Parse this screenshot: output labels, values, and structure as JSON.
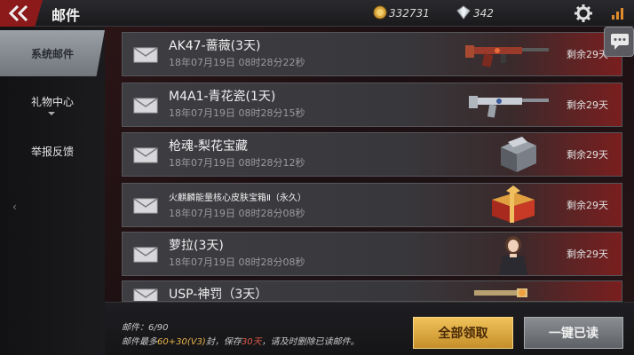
{
  "header": {
    "title": "邮件",
    "gold": "332731",
    "gems": "342",
    "back_icon": "back-chevron-icon",
    "settings_icon": "gear-icon",
    "signal_icon": "signal-bars-icon"
  },
  "sidebar": {
    "items": [
      {
        "label": "系统邮件",
        "active": true
      },
      {
        "label": "礼物中心",
        "active": false
      },
      {
        "label": "举报反馈",
        "active": false
      }
    ]
  },
  "mails": [
    {
      "title": "AK47-蔷薇(3天)",
      "date": "18年07月19日 08时28分22秒",
      "remaining": "剩余29天",
      "item_icon": "rifle-icon"
    },
    {
      "title": "M4A1-青花瓷(1天)",
      "date": "18年07月19日 08时28分15秒",
      "remaining": "剩余29天",
      "item_icon": "rifle-icon"
    },
    {
      "title": "枪魂-梨花宝藏",
      "date": "18年07月19日 08时28分12秒",
      "remaining": "剩余29天",
      "item_icon": "treasure-box-icon"
    },
    {
      "title": "火麒麟能量核心皮肤宝箱Ⅱ（永久）",
      "date": "18年07月19日 08时28分08秒",
      "remaining": "剩余29天",
      "item_icon": "gift-chest-icon"
    },
    {
      "title": "萝拉(3天)",
      "date": "18年07月19日 08时28分08秒",
      "remaining": "剩余29天",
      "item_icon": "character-icon"
    },
    {
      "title": "USP-神罚（3天）",
      "date": "",
      "remaining": "",
      "item_icon": "pistol-icon"
    }
  ],
  "footer": {
    "count_label": "邮件：",
    "count_value": "6/90",
    "rule_prefix": "邮件最多",
    "rule_max": "60+30(V3)",
    "rule_mid": "封，保存",
    "rule_days": "30天",
    "rule_suffix": "，请及时删除已读邮件。",
    "collect_all": "全部领取",
    "mark_read": "一键已读"
  },
  "colors": {
    "accent_red": "#8c1a1a",
    "gold_button": "#e0aa45",
    "highlight_yellow": "#e8b34a",
    "highlight_red": "#e25a4a"
  }
}
